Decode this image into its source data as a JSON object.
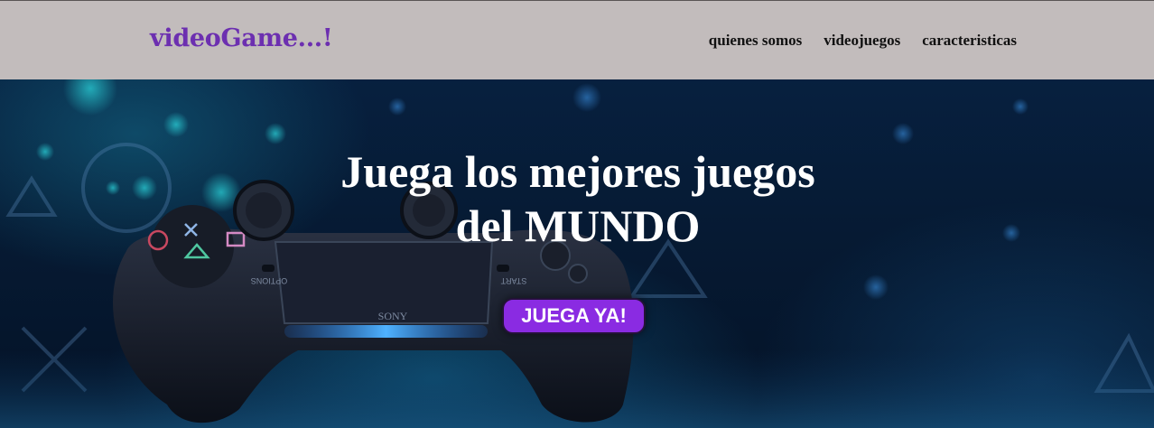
{
  "navbar": {
    "brand": "videoGame...!",
    "links": [
      {
        "label": "quienes somos"
      },
      {
        "label": "videojuegos"
      },
      {
        "label": "caracteristicas"
      }
    ]
  },
  "hero": {
    "title_line1": "Juega los mejores juegos",
    "title_line2": "del MUNDO",
    "cta_label": "JUEGA YA!",
    "controller_labels": {
      "options": "OPTIONS",
      "start": "START",
      "brand": "SONY"
    }
  },
  "colors": {
    "navbar_bg": "#c2bcbc",
    "brand": "#6c2fb0",
    "cta_bg": "#8a2be2",
    "hero_bg": "#061a33"
  }
}
